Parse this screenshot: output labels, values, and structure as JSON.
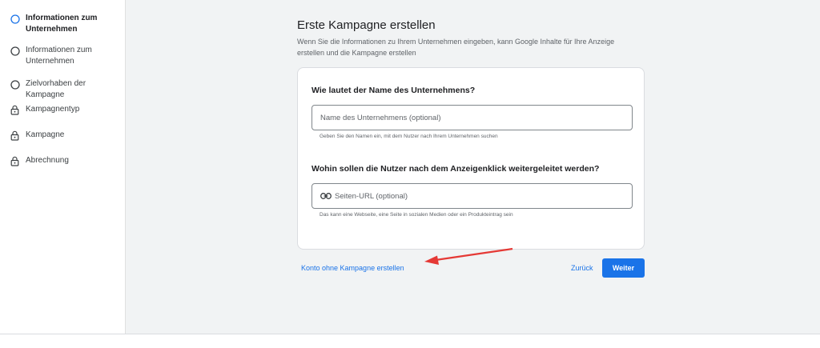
{
  "sidebar": {
    "items": [
      {
        "label": "Informationen zum Unternehmen",
        "icon": "circle-icon",
        "active": true
      },
      {
        "label": "Informationen zum Unternehmen",
        "icon": "circle-icon",
        "active": false
      },
      {
        "label": "Zielvorhaben der Kampagne",
        "icon": "circle-icon",
        "active": false
      },
      {
        "label": "Kampagnentyp",
        "icon": "lock-icon",
        "active": false
      },
      {
        "label": "Kampagne",
        "icon": "lock-icon",
        "active": false
      },
      {
        "label": "Abrechnung",
        "icon": "lock-icon",
        "active": false
      }
    ]
  },
  "main": {
    "title": "Erste Kampagne erstellen",
    "description": "Wenn Sie die Informationen zu Ihrem Unternehmen eingeben, kann Google Inhalte für Ihre Anzeige erstellen und die Kampagne erstellen",
    "business": {
      "question": "Wie lautet der Name des Unternehmens?",
      "placeholder": "Name des Unternehmens (optional)",
      "value": "",
      "hint": "Geben Sie den Namen ein, mit dem Nutzer nach Ihrem Unternehmen suchen"
    },
    "url": {
      "question": "Wohin sollen die Nutzer nach dem Anzeigenklick weitergeleitet werden?",
      "placeholder": "Seiten-URL (optional)",
      "value": "",
      "icon": "link-icon",
      "hint": "Das kann eine Webseite, eine Seite in sozialen Medien oder ein Produkteintrag sein"
    }
  },
  "footer": {
    "no_campaign_label": "Konto ohne Kampagne erstellen",
    "back_label": "Zurück",
    "next_label": "Weiter"
  },
  "colors": {
    "accent": "#1a73e8",
    "annotation_arrow": "#e53935",
    "background": "#f1f3f4"
  }
}
